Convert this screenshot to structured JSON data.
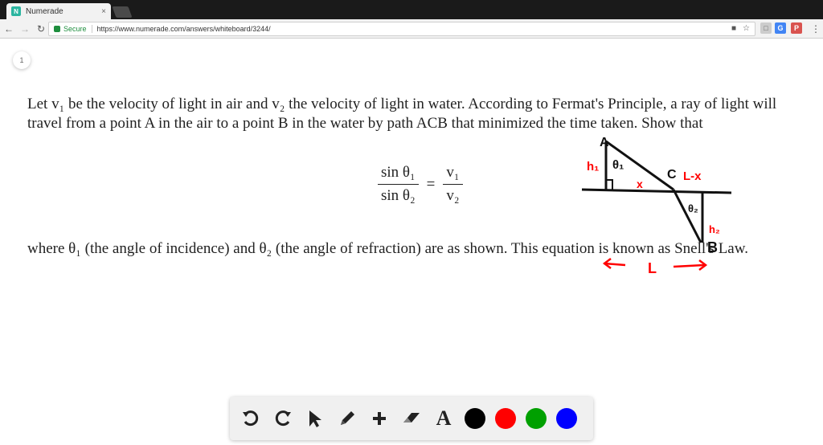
{
  "browser": {
    "tab_title": "Numerade",
    "tab_close": "×",
    "favicon_letter": "N",
    "secure_label": "Secure",
    "url": "https://www.numerade.com/answers/whiteboard/3244/"
  },
  "page": {
    "page_number": "1",
    "question_line": "Let v₁ be the velocity of light in air and v₂ the velocity of light in water. According to Fermat's Principle, a ray of light will travel from a point A in the air to a point B in the water by path ACB that minimized the time taken. Show that",
    "equation": {
      "num_left": "sin θ₁",
      "den_left": "sin θ₂",
      "equals": "=",
      "num_right": "v₁",
      "den_right": "v₂"
    },
    "conclusion": "where θ₁ (the angle of incidence) and θ₂ (the angle of refraction) are as shown. This equation is known as Snell's Law."
  },
  "sketch": {
    "labels": {
      "A": "A",
      "h1": "h₁",
      "theta1": "θ₁",
      "x": "x",
      "C": "C",
      "lx": "L-x",
      "theta2": "θ₂",
      "h2": "h₂",
      "B": "B",
      "L": "L"
    },
    "ink_color": "#111111",
    "accent_color": "#ff0000"
  },
  "drawbar": {
    "tools": [
      "undo-icon",
      "redo-icon",
      "pointer-icon",
      "pencil-icon",
      "add-icon",
      "eraser-icon",
      "text-icon"
    ],
    "text_tool_label": "A",
    "colors": [
      "#000000",
      "#ff0000",
      "#00a000",
      "#0000ff"
    ]
  }
}
